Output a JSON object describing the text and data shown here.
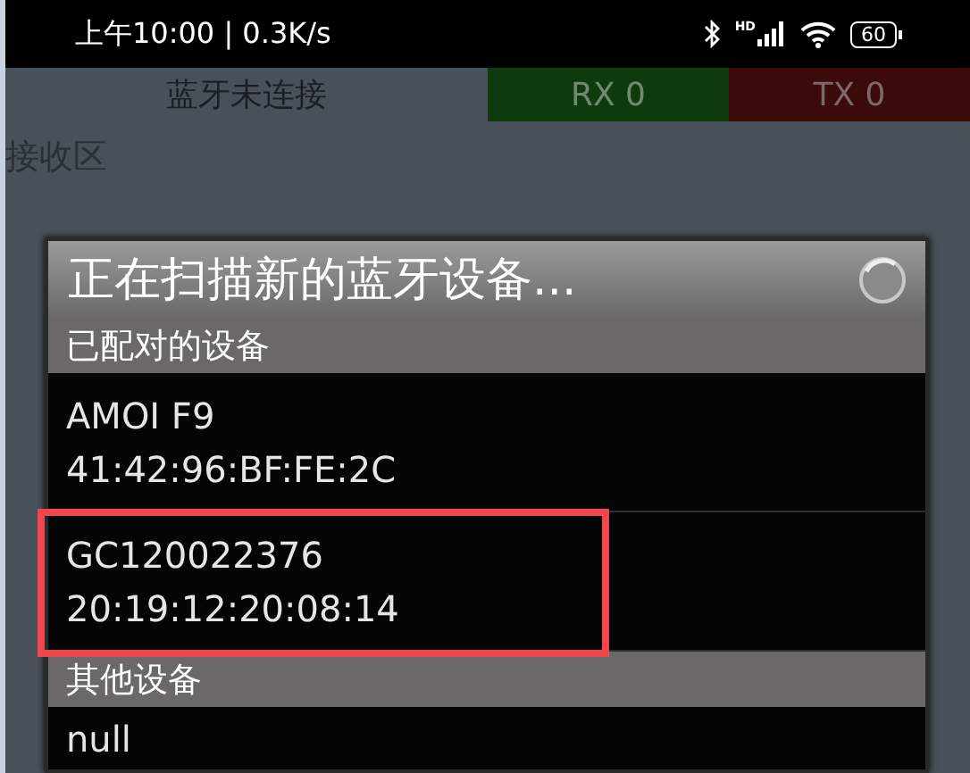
{
  "status_bar": {
    "time": "上午10:00 | 0.3K/s",
    "network_label": "HD",
    "battery": "60"
  },
  "header": {
    "connection": "蓝牙未连接",
    "rx": "RX 0",
    "tx": "TX 0"
  },
  "receive_area": {
    "label": "接收区"
  },
  "dialog": {
    "title": "正在扫描新的蓝牙设备...",
    "scanning": true,
    "sections": [
      {
        "title": "已配对的设备",
        "devices": [
          {
            "name": "AMOI F9",
            "address": "41:42:96:BF:FE:2C",
            "highlighted": false
          },
          {
            "name": "GC120022376",
            "address": "20:19:12:20:08:14",
            "highlighted": true
          }
        ]
      },
      {
        "title": "其他设备",
        "devices": [
          {
            "name": "null",
            "highlighted": false
          }
        ]
      }
    ]
  }
}
